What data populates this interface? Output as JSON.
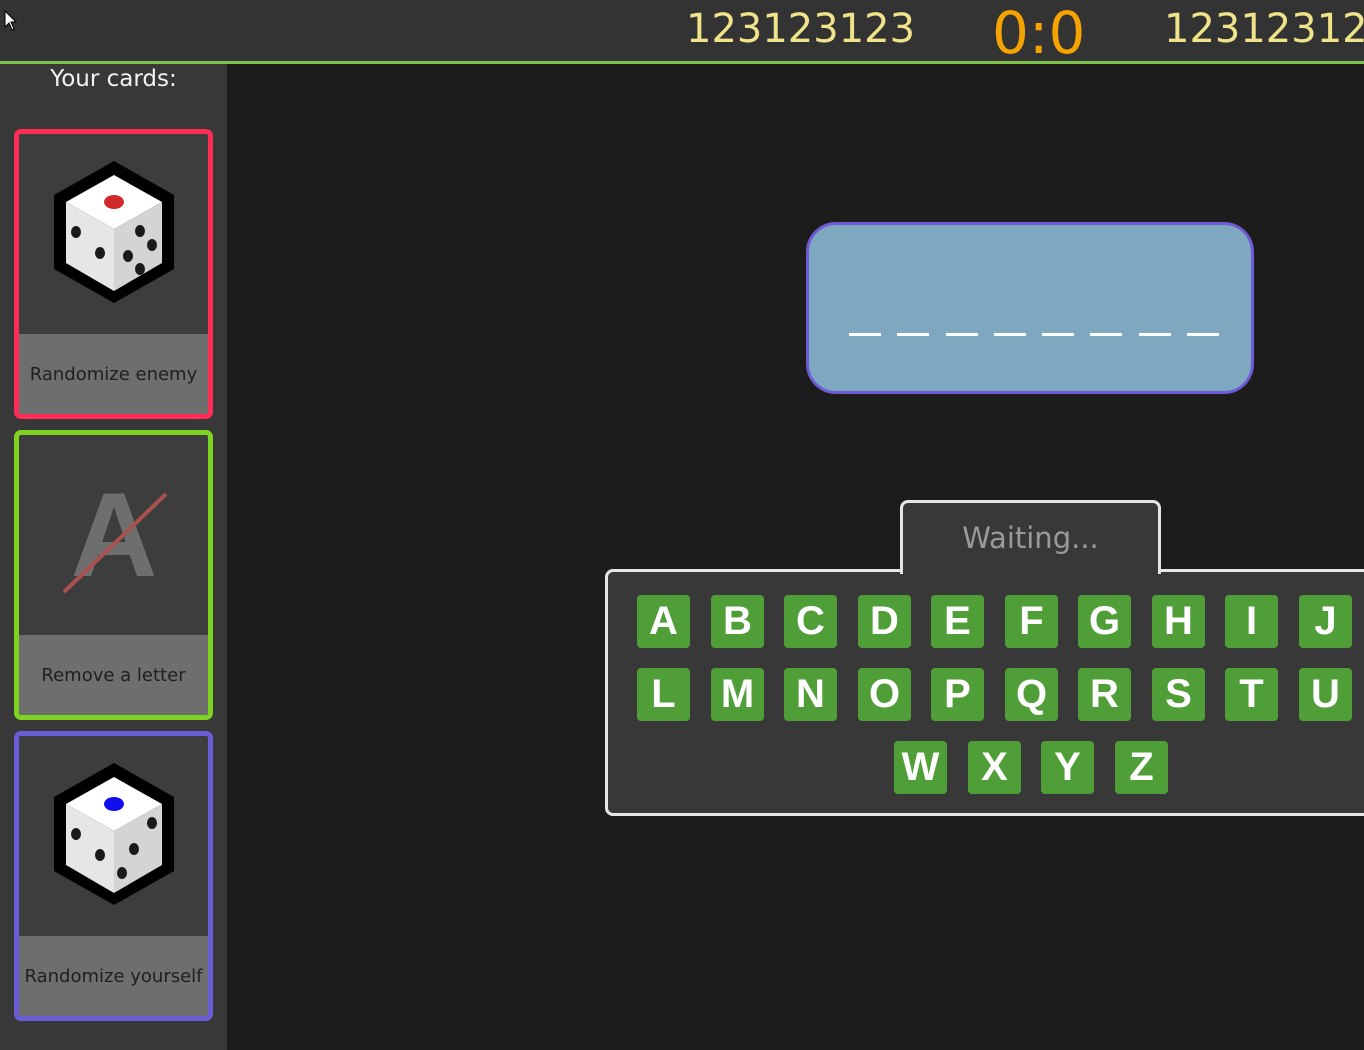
{
  "header": {
    "player_left": "123123123",
    "score": "0:0",
    "player_right": "12312312",
    "accent_color": "#7cc34a",
    "score_color": "#f5a300",
    "name_color": "#f0e48a"
  },
  "sidebar": {
    "title": "Your cards:",
    "cards": [
      {
        "label": "Randomize enemy",
        "icon": "dice-icon-red",
        "border_color": "#ff2d55"
      },
      {
        "label": "Remove a letter",
        "icon": "crossed-letter-icon",
        "icon_letter": "A",
        "border_color": "#7ed321"
      },
      {
        "label": "Randomize yourself",
        "icon": "dice-icon-blue",
        "border_color": "#6a5cd6"
      }
    ]
  },
  "word": {
    "blank_count": 8
  },
  "status": {
    "text": "Waiting..."
  },
  "keyboard": {
    "rows": [
      [
        "A",
        "B",
        "C",
        "D",
        "E",
        "F",
        "G",
        "H",
        "I",
        "J"
      ],
      [
        "L",
        "M",
        "N",
        "O",
        "P",
        "Q",
        "R",
        "S",
        "T",
        "U"
      ],
      [
        "W",
        "X",
        "Y",
        "Z"
      ]
    ],
    "key_color": "#4f9e38"
  }
}
